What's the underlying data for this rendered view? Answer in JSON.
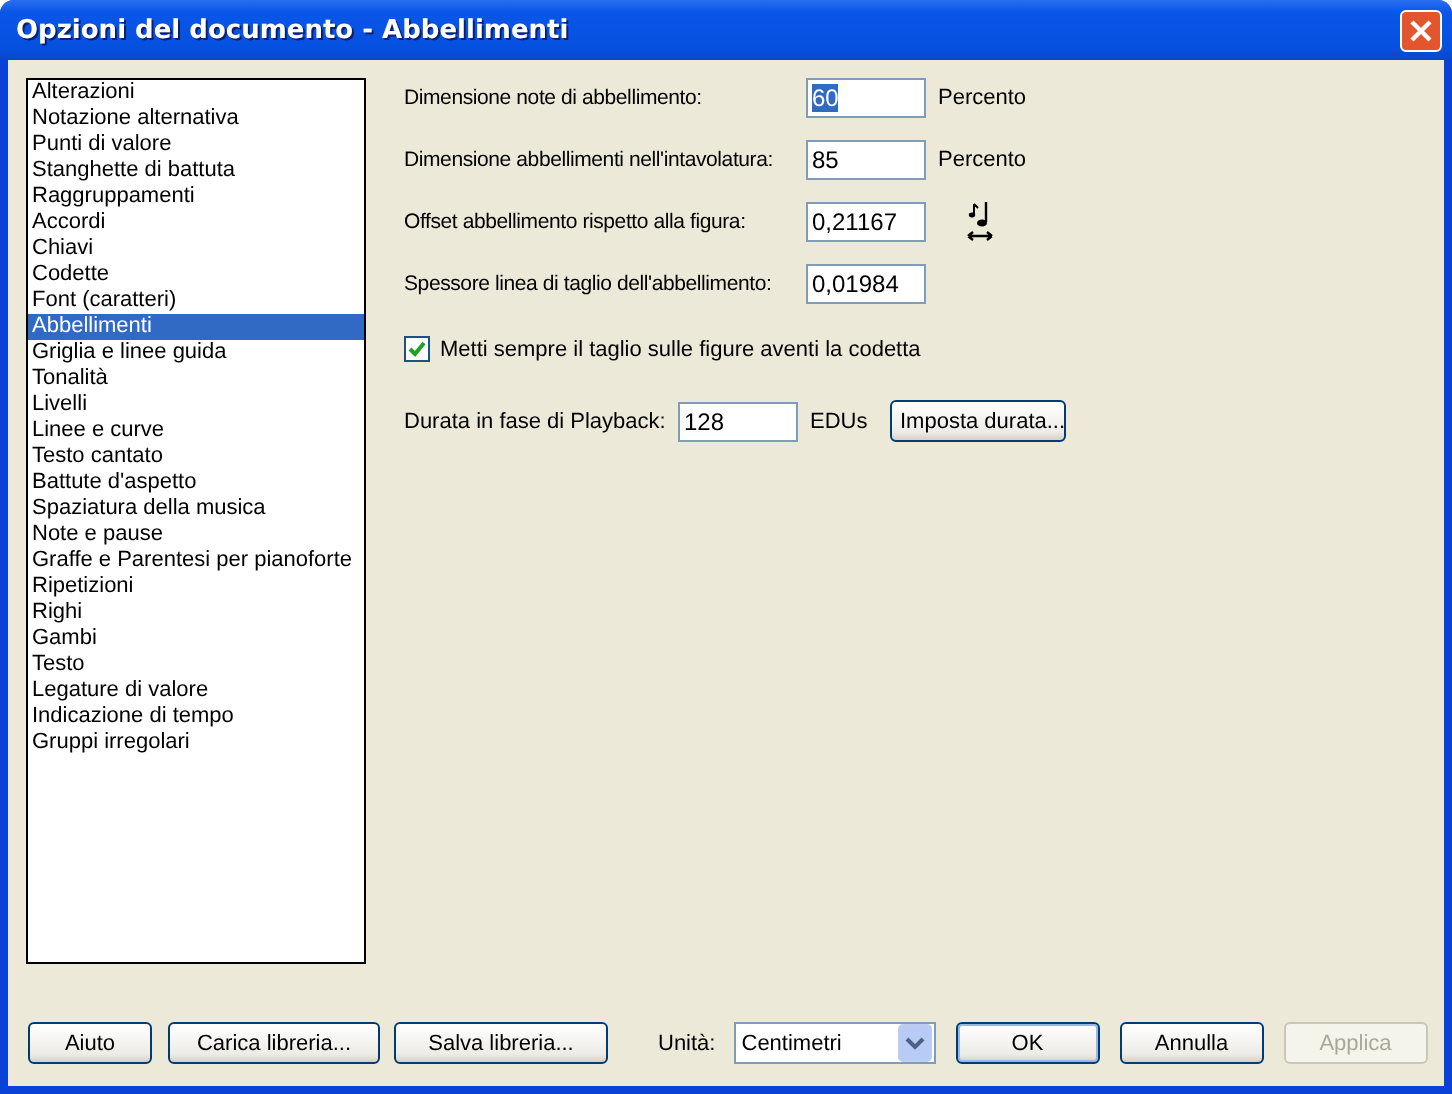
{
  "window": {
    "title": "Opzioni del documento - Abbellimenti"
  },
  "sidebar": {
    "items": [
      {
        "label": "Alterazioni",
        "selected": false
      },
      {
        "label": "Notazione alternativa",
        "selected": false
      },
      {
        "label": "Punti di valore",
        "selected": false
      },
      {
        "label": "Stanghette di battuta",
        "selected": false
      },
      {
        "label": "Raggruppamenti",
        "selected": false
      },
      {
        "label": "Accordi",
        "selected": false
      },
      {
        "label": "Chiavi",
        "selected": false
      },
      {
        "label": "Codette",
        "selected": false
      },
      {
        "label": "Font (caratteri)",
        "selected": false
      },
      {
        "label": "Abbellimenti",
        "selected": true
      },
      {
        "label": "Griglia e linee guida",
        "selected": false
      },
      {
        "label": "Tonalità",
        "selected": false
      },
      {
        "label": "Livelli",
        "selected": false
      },
      {
        "label": "Linee e curve",
        "selected": false
      },
      {
        "label": "Testo cantato",
        "selected": false
      },
      {
        "label": "Battute d'aspetto",
        "selected": false
      },
      {
        "label": "Spaziatura della musica",
        "selected": false
      },
      {
        "label": "Note e pause",
        "selected": false
      },
      {
        "label": "Graffe e Parentesi per pianoforte",
        "selected": false
      },
      {
        "label": "Ripetizioni",
        "selected": false
      },
      {
        "label": "Righi",
        "selected": false
      },
      {
        "label": "Gambi",
        "selected": false
      },
      {
        "label": "Testo",
        "selected": false
      },
      {
        "label": "Legature di valore",
        "selected": false
      },
      {
        "label": "Indicazione di tempo",
        "selected": false
      },
      {
        "label": "Gruppi irregolari",
        "selected": false
      }
    ]
  },
  "fields": [
    {
      "label": "Dimensione note di abbellimento:",
      "value": "60",
      "selected": true,
      "unit": "Percento"
    },
    {
      "label": "Dimensione abbellimenti nell'intavolatura:",
      "value": "85",
      "selected": false,
      "unit": "Percento"
    },
    {
      "label": "Offset abbellimento rispetto alla figura:",
      "value": "0,21167",
      "selected": false,
      "kind": "icon"
    },
    {
      "label": "Spessore linea di taglio dell'abbellimento:",
      "value": "0,01984",
      "selected": false
    }
  ],
  "checkbox": {
    "label": "Metti sempre il taglio sulle figure aventi la codetta",
    "checked": true
  },
  "playback": {
    "label": "Durata in fase di Playback:",
    "value": "128",
    "unit": "EDUs",
    "button": "Imposta durata..."
  },
  "footer": {
    "buttons_left": [
      {
        "label": "Aiuto",
        "disabled": false
      },
      {
        "label": "Carica libreria...",
        "disabled": false
      },
      {
        "label": "Salva libreria...",
        "disabled": false
      }
    ],
    "units_label": "Unità:",
    "units_value": "Centimetri",
    "buttons_right": [
      {
        "label": "OK",
        "disabled": false
      },
      {
        "label": "Annulla",
        "disabled": false
      },
      {
        "label": "Applica",
        "disabled": true
      }
    ]
  }
}
